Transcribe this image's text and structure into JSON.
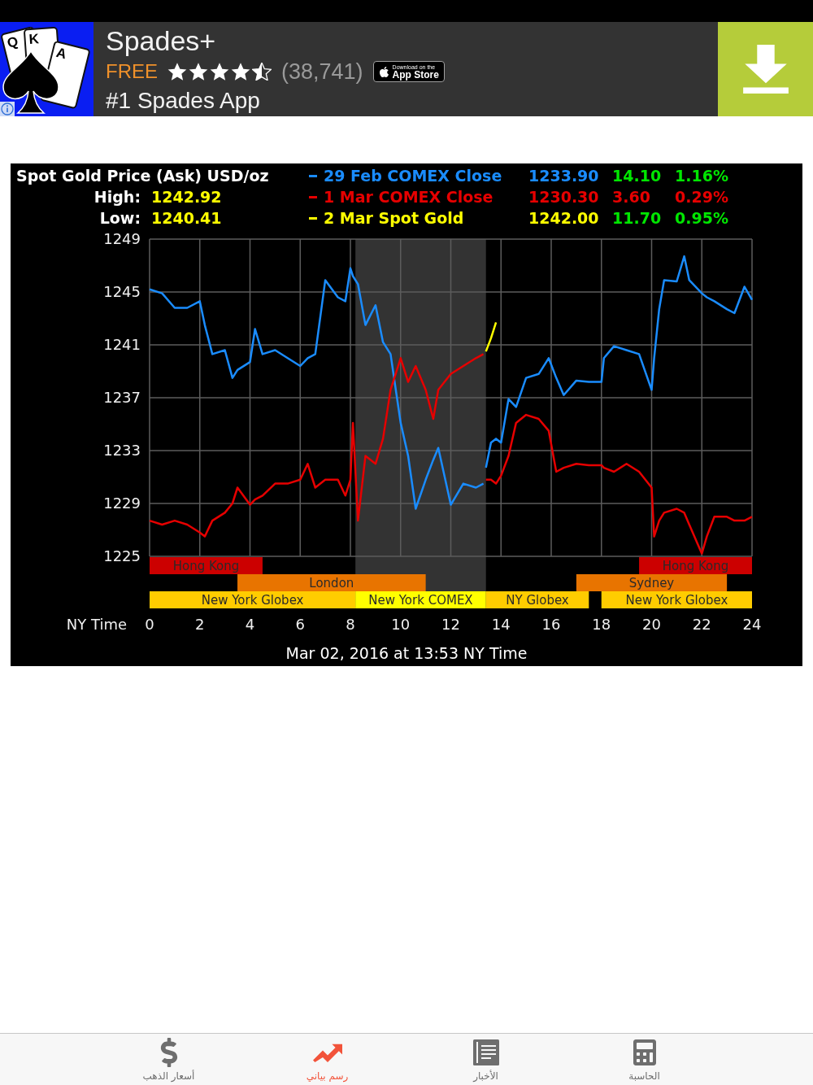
{
  "ad": {
    "icon_cards": [
      "Q",
      "K",
      "A"
    ],
    "title": "Spades+",
    "price": "FREE",
    "stars": 4.5,
    "rating_count": "(38,741)",
    "badge": {
      "line_1": "Download on the",
      "line_2": "App Store"
    },
    "subtitle": "#1 Spades App"
  },
  "chart": {
    "title": "Spot Gold Price (Ask) USD/oz",
    "stats": [
      {
        "label": "High:",
        "value": "1242.92"
      },
      {
        "label": "Low:",
        "value": "1240.41"
      }
    ],
    "quotes": [
      {
        "price": "1233.90",
        "change": "14.10",
        "percent": "1.16%",
        "down": false
      },
      {
        "price": "1230.30",
        "change": "3.60",
        "percent": "0.29%",
        "down": true
      },
      {
        "price": "1242.00",
        "change": "11.70",
        "percent": "0.95%",
        "down": false
      }
    ],
    "chart_data": {
      "type": "line",
      "xlabel": "NY Time",
      "grid": true,
      "x": [
        0,
        0.5,
        1,
        1.5,
        2,
        2.2,
        2.5,
        3,
        3.3,
        3.5,
        4,
        4.2,
        4.5,
        5,
        5.5,
        6,
        6.3,
        6.6,
        7,
        7.5,
        7.8,
        8,
        8.1,
        8.3,
        8.6,
        9,
        9.3,
        9.6,
        10,
        10.3,
        10.6,
        11,
        11.3,
        11.5,
        12,
        12.5,
        13,
        13.3,
        13.35,
        13.4,
        13.6,
        13.8,
        14,
        14.3,
        14.6,
        15,
        15.5,
        15.9,
        16.2,
        16.5,
        17,
        17.5,
        18,
        18.1,
        18.5,
        19,
        19.5,
        20,
        20.1,
        20.3,
        20.5,
        21,
        21.3,
        21.5,
        22,
        22.2,
        22.5,
        23,
        23.3,
        23.7,
        24
      ],
      "series": [
        {
          "name": "29 Feb COMEX Close",
          "color": "#1a8cff",
          "values": [
            1245.2,
            1244.9,
            1243.8,
            1243.8,
            1244.3,
            1242.5,
            1240.3,
            1240.6,
            1238.5,
            1239.1,
            1239.7,
            1242.2,
            1240.3,
            1240.6,
            1240.0,
            1239.4,
            1240.0,
            1240.3,
            1245.9,
            1244.6,
            1244.3,
            1246.8,
            1246.2,
            1245.6,
            1242.5,
            1244.0,
            1241.2,
            1240.3,
            1235.1,
            1232.6,
            1228.6,
            1230.8,
            1232.3,
            1233.2,
            1228.9,
            1230.5,
            1230.2,
            1230.5,
            null,
            1231.7,
            1233.6,
            1233.9,
            1233.6,
            1236.9,
            1236.3,
            1238.5,
            1238.8,
            1240.0,
            1238.5,
            1237.2,
            1238.3,
            1238.2,
            1238.2,
            1240.0,
            1240.9,
            1240.6,
            1240.3,
            1237.6,
            1240.0,
            1243.7,
            1245.9,
            1245.8,
            1247.7,
            1245.9,
            1244.9,
            1244.6,
            1244.3,
            1243.7,
            1243.4,
            1245.4,
            1244.4
          ]
        },
        {
          "name": "1 Mar COMEX Close",
          "color": "#e60000",
          "values": [
            1227.7,
            1227.4,
            1227.7,
            1227.4,
            1226.8,
            1226.5,
            1227.7,
            1228.3,
            1229.0,
            1230.2,
            1228.9,
            1229.3,
            1229.6,
            1230.5,
            1230.5,
            1230.8,
            1232.0,
            1230.2,
            1230.8,
            1230.8,
            1229.6,
            1230.8,
            1235.1,
            1227.7,
            1232.6,
            1232.0,
            1233.9,
            1237.6,
            1240.0,
            1238.2,
            1239.4,
            1237.6,
            1235.4,
            1237.6,
            1238.8,
            1239.4,
            1240.0,
            1240.3,
            null,
            1230.8,
            1230.8,
            1230.5,
            1231.1,
            1232.6,
            1235.1,
            1235.7,
            1235.4,
            1234.5,
            1231.4,
            1231.7,
            1232.0,
            1231.9,
            1231.9,
            1231.7,
            1231.4,
            1232.0,
            1231.4,
            1230.2,
            1226.5,
            1227.7,
            1228.3,
            1228.6,
            1228.3,
            1227.4,
            1225.2,
            1226.5,
            1228.0,
            1228.0,
            1227.7,
            1227.7,
            1228.0
          ]
        },
        {
          "name": "2 Mar Spot Gold",
          "color": "#ffff00",
          "values": [
            null,
            null,
            null,
            null,
            null,
            null,
            null,
            null,
            null,
            null,
            null,
            null,
            null,
            null,
            null,
            null,
            null,
            null,
            null,
            null,
            null,
            null,
            null,
            null,
            null,
            null,
            null,
            null,
            null,
            null,
            null,
            null,
            null,
            null,
            null,
            null,
            null,
            null,
            null,
            1240.5,
            1241.5,
            1242.7,
            null,
            null,
            null,
            null,
            null,
            null,
            null,
            null,
            null,
            null,
            null,
            null,
            null,
            null,
            null,
            null,
            null,
            null,
            null,
            null,
            null,
            null,
            null,
            null,
            null,
            null,
            null,
            null,
            null
          ]
        }
      ],
      "xlim": [
        0,
        24
      ],
      "ylim": [
        1225,
        1249
      ],
      "xticks": [
        0,
        2,
        4,
        6,
        8,
        10,
        12,
        14,
        16,
        18,
        20,
        22,
        24
      ],
      "yticks": [
        1225,
        1229,
        1233,
        1237,
        1241,
        1245,
        1249
      ],
      "bands": [
        {
          "axis": "x",
          "from": 8.2,
          "to": 13.4,
          "color": "#333333"
        }
      ]
    },
    "sessions": [
      {
        "label": "Hong Kong",
        "color": "#cc0000"
      },
      {
        "label": "Hong Kong",
        "color": "#cc0000"
      },
      {
        "label": "London",
        "color": "#e87400"
      },
      {
        "label": "Sydney",
        "color": "#e87400"
      },
      {
        "label": "New York Globex",
        "color": "#ffcc00"
      },
      {
        "label": "New York COMEX",
        "color": "#ffff00"
      },
      {
        "label": "NY Globex",
        "color": "#ffcc00"
      },
      {
        "label": "New York Globex",
        "color": "#ffcc00"
      }
    ],
    "timestamp": "Mar 02, 2016 at 13:53 NY Time"
  },
  "tabs": [
    {
      "kind": "calculator",
      "label": "الحاسبة",
      "selected": false
    },
    {
      "kind": "news",
      "label": "الأخبار",
      "selected": false
    },
    {
      "kind": "chart",
      "label": "رسم بياني",
      "selected": true
    },
    {
      "kind": "dollar",
      "label": "أسعار الذهب",
      "selected": false
    }
  ]
}
